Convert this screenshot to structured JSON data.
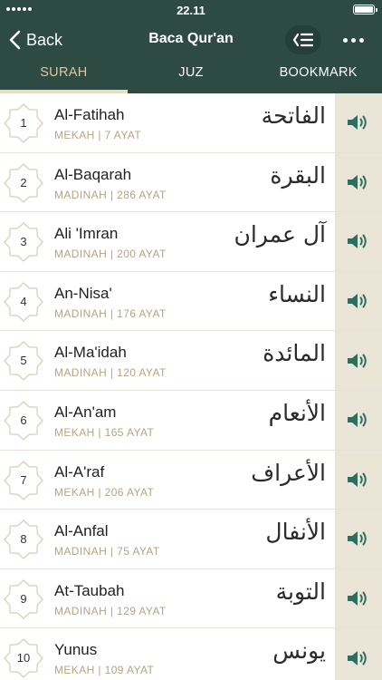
{
  "status": {
    "time": "22.11"
  },
  "nav": {
    "back_label": "Back",
    "title": "Baca Qur'an"
  },
  "tabs": [
    {
      "label": "SURAH",
      "active": true
    },
    {
      "label": "JUZ",
      "active": false
    },
    {
      "label": "BOOKMARK",
      "active": false
    }
  ],
  "colors": {
    "header": "#2d4a43",
    "accent": "#2d6e5e",
    "tab_active": "#d9c9a3",
    "audio_bg": "#eae5d6",
    "info_text": "#b4a582"
  },
  "icons": {
    "back": "chevron-left-icon",
    "list": "list-icon",
    "more": "more-dots-icon",
    "audio": "speaker-icon",
    "badge": "star-octagon-icon"
  },
  "surahs": [
    {
      "number": "1",
      "name": "Al-Fatihah",
      "info": "MEKAH | 7 AYAT",
      "arabic": "الفاتحة"
    },
    {
      "number": "2",
      "name": "Al-Baqarah",
      "info": "MADINAH | 286 AYAT",
      "arabic": "البقرة"
    },
    {
      "number": "3",
      "name": "Ali 'Imran",
      "info": "MADINAH | 200 AYAT",
      "arabic": "آل عمران"
    },
    {
      "number": "4",
      "name": "An-Nisa'",
      "info": "MADINAH | 176 AYAT",
      "arabic": "النساء"
    },
    {
      "number": "5",
      "name": "Al-Ma'idah",
      "info": "MADINAH | 120 AYAT",
      "arabic": "المائدة"
    },
    {
      "number": "6",
      "name": "Al-An'am",
      "info": "MEKAH | 165 AYAT",
      "arabic": "الأنعام"
    },
    {
      "number": "7",
      "name": "Al-A'raf",
      "info": "MEKAH | 206 AYAT",
      "arabic": "الأعراف"
    },
    {
      "number": "8",
      "name": "Al-Anfal",
      "info": "MADINAH | 75 AYAT",
      "arabic": "الأنفال"
    },
    {
      "number": "9",
      "name": "At-Taubah",
      "info": "MADINAH | 129 AYAT",
      "arabic": "التوبة"
    },
    {
      "number": "10",
      "name": "Yunus",
      "info": "MEKAH | 109 AYAT",
      "arabic": "يونس"
    }
  ]
}
